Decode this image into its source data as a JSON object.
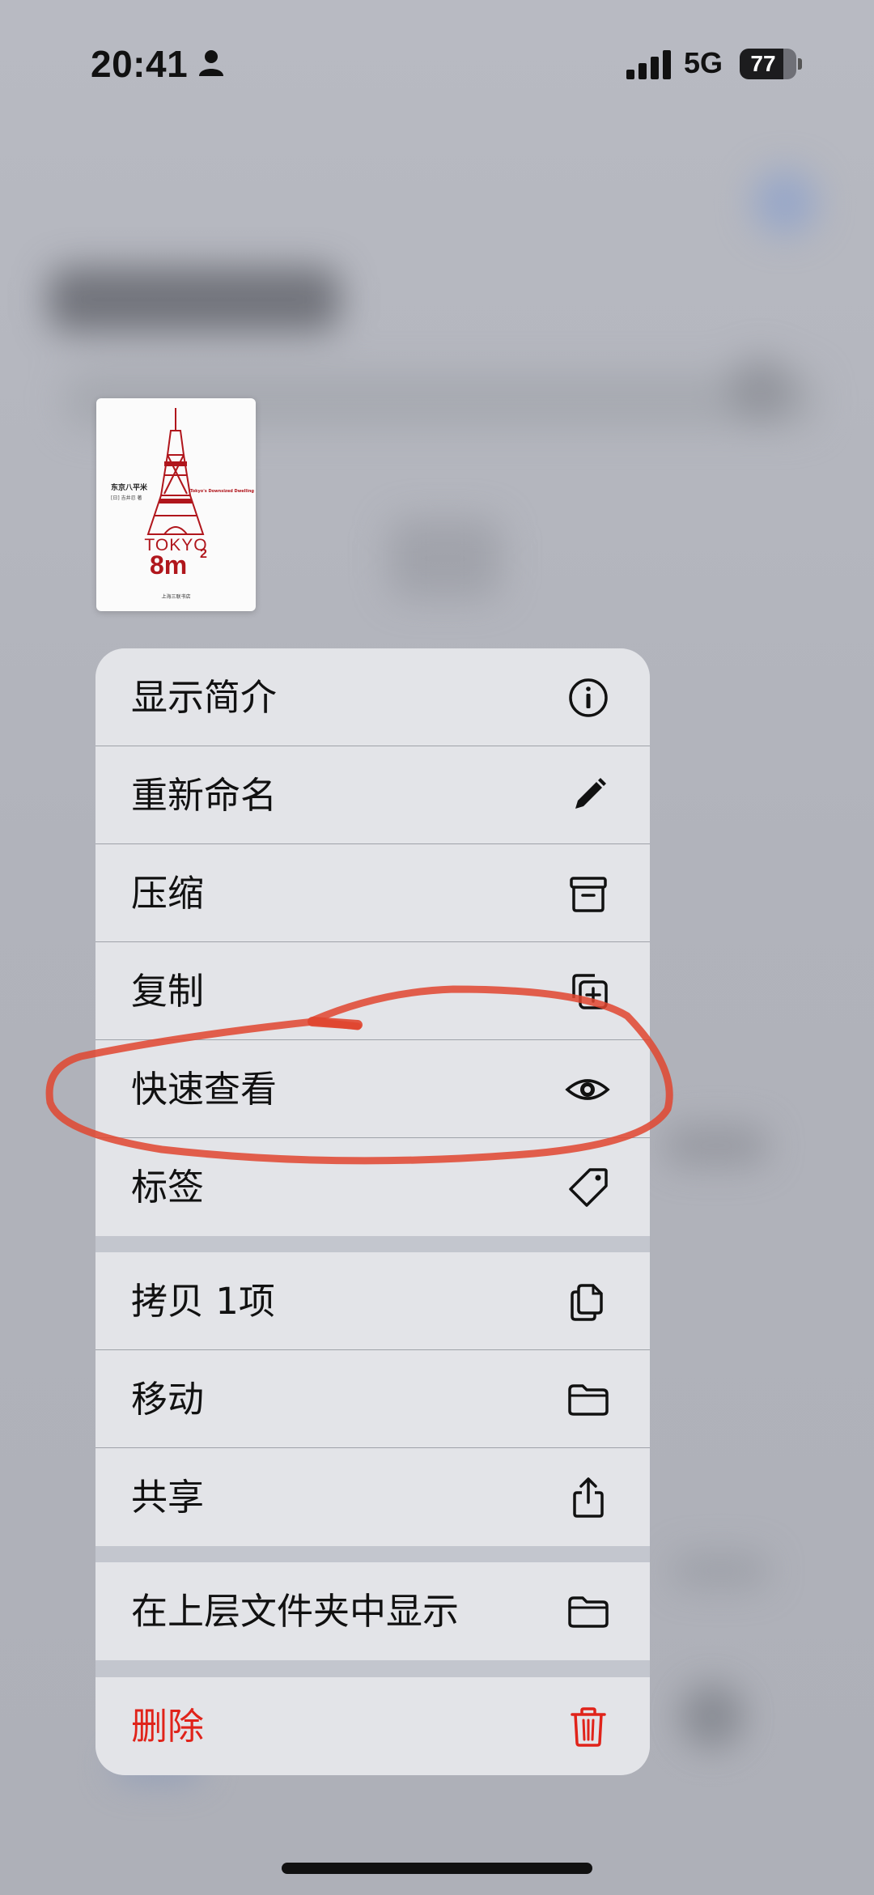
{
  "status_bar": {
    "time": "20:41",
    "network": "5G",
    "battery": "77"
  },
  "book": {
    "cn_title": "东京八平米",
    "author": "[日] 吉井忍 著",
    "en_subtitle": "Tokyo's Downsized Dwelling",
    "tokyo": "TOKYO",
    "size": "8m",
    "size_sup": "2",
    "publisher": "上海三联书店"
  },
  "menu": {
    "groups": [
      [
        {
          "label": "显示简介",
          "icon": "info-icon"
        },
        {
          "label": "重新命名",
          "icon": "pencil-icon"
        },
        {
          "label": "压缩",
          "icon": "archive-box-icon"
        },
        {
          "label": "复制",
          "icon": "duplicate-icon"
        },
        {
          "label": "快速查看",
          "icon": "eye-icon"
        },
        {
          "label": "标签",
          "icon": "tag-icon"
        }
      ],
      [
        {
          "label": "拷贝 1项",
          "icon": "copy-documents-icon"
        },
        {
          "label": "移动",
          "icon": "folder-icon"
        },
        {
          "label": "共享",
          "icon": "share-icon"
        }
      ],
      [
        {
          "label": "在上层文件夹中显示",
          "icon": "folder-icon"
        }
      ],
      [
        {
          "label": "删除",
          "icon": "trash-icon",
          "destructive": true
        }
      ]
    ]
  },
  "colors": {
    "destructive": "#e0231a",
    "annotation": "#e0452f",
    "menu_bg": "#e3e4e8"
  }
}
